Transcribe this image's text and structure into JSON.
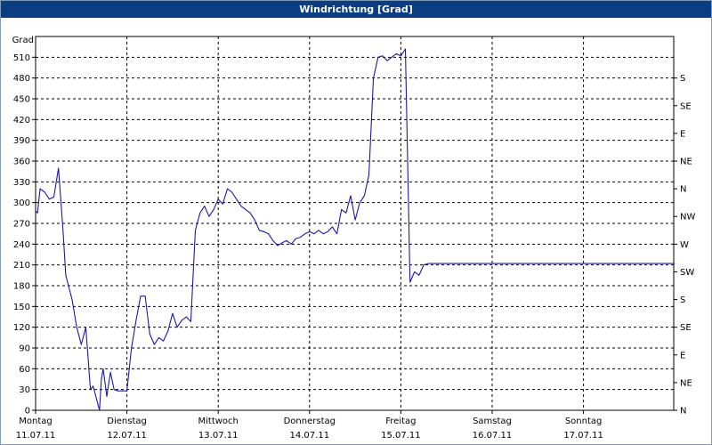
{
  "window": {
    "title": "Windrichtung [Grad]"
  },
  "colors": {
    "titlebar": "#0a3d82",
    "line": "#1a1aa6",
    "grid": "#000000"
  },
  "chart_data": {
    "type": "line",
    "title": "Windrichtung [Grad]",
    "ylabel": "Grad",
    "ylim": [
      0,
      540
    ],
    "yticks": [
      0,
      30,
      60,
      90,
      120,
      150,
      180,
      210,
      240,
      270,
      300,
      330,
      360,
      390,
      420,
      450,
      480,
      510
    ],
    "right_axis_labels": [
      {
        "value": 0,
        "label": "N"
      },
      {
        "value": 40,
        "label": "NE"
      },
      {
        "value": 80,
        "label": "E"
      },
      {
        "value": 120,
        "label": "SE"
      },
      {
        "value": 160,
        "label": "S"
      },
      {
        "value": 200,
        "label": "SW"
      },
      {
        "value": 240,
        "label": "W"
      },
      {
        "value": 280,
        "label": "NW"
      },
      {
        "value": 320,
        "label": "N"
      },
      {
        "value": 360,
        "label": "NE"
      },
      {
        "value": 400,
        "label": "E"
      },
      {
        "value": 440,
        "label": "SE"
      },
      {
        "value": 480,
        "label": "S"
      }
    ],
    "xlim": [
      0,
      7
    ],
    "x_labels": [
      {
        "day": "Montag",
        "date": "11.07.11"
      },
      {
        "day": "Dienstag",
        "date": "12.07.11"
      },
      {
        "day": "Mittwoch",
        "date": "13.07.11"
      },
      {
        "day": "Donnerstag",
        "date": "14.07.11"
      },
      {
        "day": "Freitag",
        "date": "15.07.11"
      },
      {
        "day": "Samstag",
        "date": "16.07.11"
      },
      {
        "day": "Sonntag",
        "date": "17.07.11"
      }
    ],
    "grid": true,
    "series": [
      {
        "x": [
          0.0,
          0.02,
          0.05,
          0.1,
          0.15,
          0.2,
          0.25,
          0.3,
          0.33,
          0.36,
          0.4,
          0.45,
          0.5,
          0.55,
          0.6,
          0.63,
          0.66,
          0.7,
          0.72,
          0.74,
          0.78,
          0.82,
          0.86,
          0.9,
          0.95,
          1.0,
          1.05,
          1.1,
          1.15,
          1.2,
          1.25,
          1.3,
          1.35,
          1.4,
          1.45,
          1.5,
          1.55,
          1.6,
          1.65,
          1.7,
          1.75,
          1.8,
          1.85,
          1.9,
          1.95,
          2.0,
          2.05,
          2.1,
          2.15,
          2.2,
          2.25,
          2.3,
          2.35,
          2.4,
          2.45,
          2.5,
          2.55,
          2.6,
          2.65,
          2.7,
          2.75,
          2.8,
          2.85,
          2.9,
          2.95,
          3.0,
          3.05,
          3.1,
          3.15,
          3.2,
          3.25,
          3.3,
          3.35,
          3.4,
          3.45,
          3.5,
          3.55,
          3.6,
          3.65,
          3.7,
          3.75,
          3.8,
          3.85,
          3.9,
          3.95,
          4.0,
          4.05,
          4.1,
          4.15,
          4.2,
          4.25,
          4.3,
          4.35,
          4.4,
          4.45,
          4.5,
          4.55,
          4.6,
          4.65,
          4.7,
          4.75,
          4.8,
          4.85,
          4.9,
          4.95,
          5.0,
          5.05,
          5.1,
          5.15,
          5.2,
          5.25,
          5.3,
          5.35,
          5.4,
          5.45,
          5.5,
          5.55,
          5.6,
          5.65,
          5.7,
          6.0,
          6.5,
          7.0
        ],
        "values": [
          288,
          285,
          320,
          315,
          305,
          308,
          350,
          260,
          195,
          180,
          160,
          120,
          95,
          120,
          30,
          35,
          20,
          0,
          45,
          60,
          20,
          55,
          30,
          28,
          28,
          28,
          90,
          130,
          165,
          165,
          110,
          95,
          105,
          100,
          115,
          140,
          120,
          130,
          135,
          128,
          260,
          285,
          295,
          280,
          290,
          305,
          298,
          320,
          315,
          305,
          295,
          290,
          285,
          275,
          260,
          258,
          255,
          245,
          238,
          242,
          245,
          240,
          248,
          250,
          255,
          258,
          255,
          260,
          255,
          258,
          265,
          255,
          290,
          285,
          310,
          275,
          300,
          310,
          340,
          480,
          510,
          512,
          505,
          510,
          515,
          512,
          522,
          185,
          200,
          195,
          210,
          212,
          212,
          212,
          212,
          212,
          212,
          212,
          212,
          212,
          212,
          212,
          212,
          212,
          212,
          212,
          212,
          212,
          212,
          212,
          212,
          212,
          212,
          212,
          212,
          212,
          212,
          212,
          212,
          212,
          212,
          212,
          212
        ]
      }
    ]
  }
}
